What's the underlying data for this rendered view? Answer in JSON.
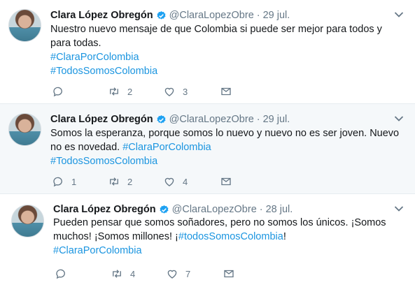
{
  "tweets": [
    {
      "name": "Clara López Obregón",
      "handle": "@ClaraLopezObre",
      "separator": "·",
      "date": "29 jul.",
      "text_lines": [
        "Nuestro nuevo mensaje de que Colombia si puede ser mejor para todos y",
        "para todas."
      ],
      "hashtags": [
        "#ClaraPorColombia",
        "#TodosSomosColombia"
      ],
      "reply_count": "",
      "retweet_count": "2",
      "like_count": "3"
    },
    {
      "name": "Clara López Obregón",
      "handle": "@ClaraLopezObre",
      "separator": "·",
      "date": "29 jul.",
      "text_line1": "Somos la esperanza, porque somos lo nuevo y nuevo no es ser joven. Nuevo",
      "text_line2": "no es novedad.",
      "hashtag_inline": "#ClaraPorColombia",
      "hashtag_line": "#TodosSomosColombia",
      "reply_count": "1",
      "retweet_count": "2",
      "like_count": "4"
    },
    {
      "name": "Clara López Obregón",
      "handle": "@ClaraLopezObre",
      "separator": "·",
      "date": "28 jul.",
      "text_line1": "Pueden pensar que somos soñadores, pero no somos los únicos. ¡Somos",
      "text_line2_a": "muchos! ¡Somos millones! ¡",
      "hashtag_inline": "#todosSomosColombia",
      "text_line2_b": "!",
      "hashtag_line": "#ClaraPorColombia",
      "reply_count": "",
      "retweet_count": "4",
      "like_count": "7"
    }
  ],
  "icons": {
    "verified": "verified-badge-icon",
    "caret": "chevron-down-icon",
    "reply": "reply-icon",
    "retweet": "retweet-icon",
    "like": "heart-icon",
    "dm": "envelope-icon"
  },
  "colors": {
    "link": "#1b95e0",
    "secondary_text": "#657786",
    "verified": "#1da1f2",
    "hover_bg": "#f5f8fa"
  }
}
